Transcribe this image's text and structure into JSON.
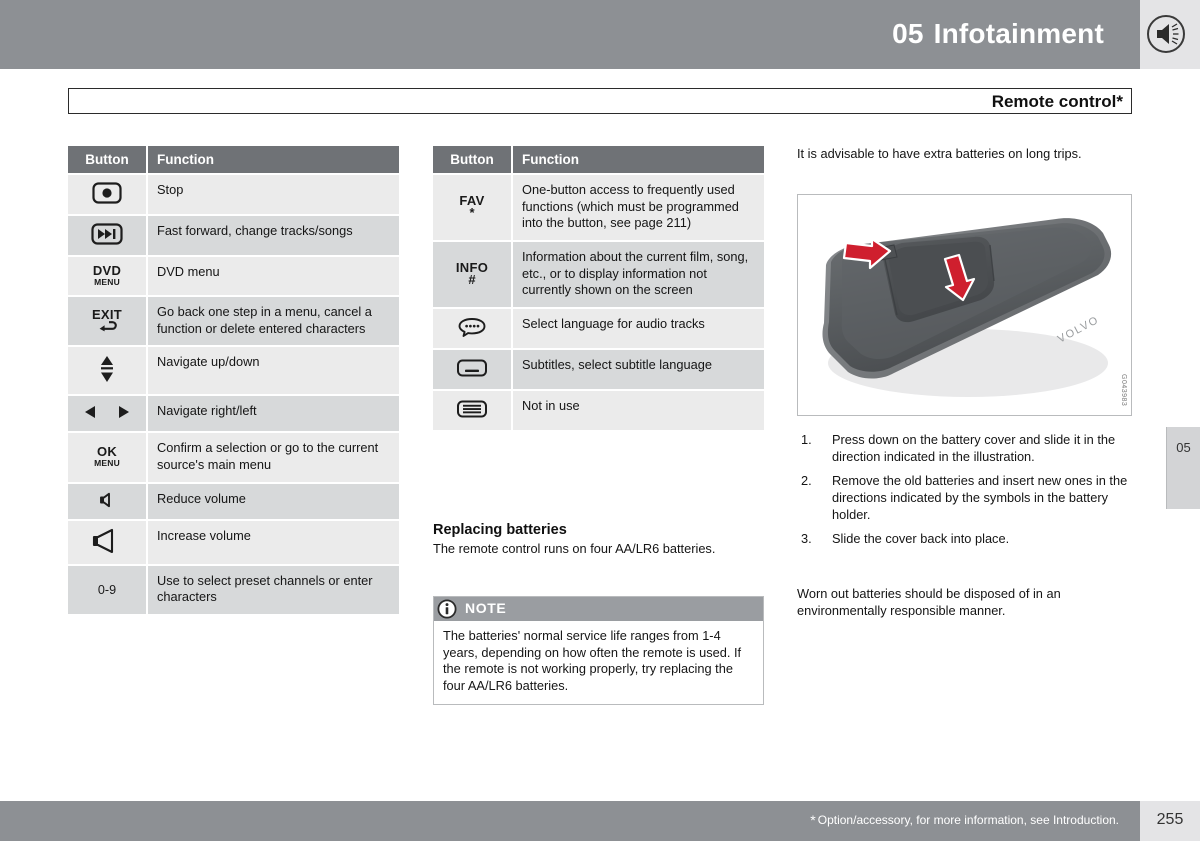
{
  "header": {
    "chapter_number": "05",
    "chapter_title": "Infotainment",
    "speaker_icon": "speaker-icon"
  },
  "section": {
    "title": "Remote control*"
  },
  "table_left": {
    "columns": [
      "Button",
      "Function"
    ],
    "rows": [
      {
        "button_icon": "stop-icon",
        "button_label": "",
        "function": "Stop"
      },
      {
        "button_icon": "fast-forward-icon",
        "button_label": "",
        "function": "Fast forward, change tracks/songs"
      },
      {
        "button_icon": "dvd-menu-text",
        "button_label": "DVD",
        "button_sublabel": "MENU",
        "function": "DVD menu"
      },
      {
        "button_icon": "exit-icon",
        "button_label": "EXIT",
        "function": "Go back one step in a menu, cancel a function or delete entered characters"
      },
      {
        "button_icon": "up-down-arrows-icon",
        "button_label": "",
        "function": "Navigate up/down"
      },
      {
        "button_icon": "left-right-arrows-icon",
        "button_label": "",
        "function": "Navigate right/left"
      },
      {
        "button_icon": "ok-menu-text",
        "button_label": "OK",
        "button_sublabel": "MENU",
        "function": "Confirm a selection or go to the current source's main menu"
      },
      {
        "button_icon": "volume-down-icon",
        "button_label": "",
        "function": "Reduce volume"
      },
      {
        "button_icon": "volume-up-icon",
        "button_label": "",
        "function": "Increase volume"
      },
      {
        "button_icon": "number-keys-text",
        "button_label": "0-9",
        "function": "Use to select preset channels or enter characters"
      }
    ]
  },
  "table_mid": {
    "columns": [
      "Button",
      "Function"
    ],
    "rows": [
      {
        "button_icon": "fav-star-text",
        "button_label": "FAV",
        "button_sublabel": "*",
        "function": "One-button access to frequently used functions (which must be programmed into the button, see page 211)"
      },
      {
        "button_icon": "info-hash-text",
        "button_label": "INFO",
        "button_sublabel": "#",
        "function": "Information about the current film, song, etc., or to display information not currently shown on the screen"
      },
      {
        "button_icon": "audio-language-icon",
        "button_label": "",
        "function": "Select language for audio tracks"
      },
      {
        "button_icon": "subtitles-icon",
        "button_label": "",
        "function": "Subtitles, select subtitle language"
      },
      {
        "button_icon": "list-icon",
        "button_label": "",
        "function": "Not in use"
      }
    ]
  },
  "replacing_batteries": {
    "heading": "Replacing batteries",
    "intro": "The remote control runs on four AA/LR6 batteries."
  },
  "note": {
    "icon": "info-icon",
    "label": "NOTE",
    "text": "The batteries' normal service life ranges from 1-4 years, depending on how often the remote is used. If the remote is not working properly, try replacing the four AA/LR6 batteries."
  },
  "right_column": {
    "intro": "It is advisable to have extra batteries on long trips.",
    "figure": {
      "alt": "remote-control-battery-cover-illustration",
      "code": "G043983"
    },
    "steps": [
      {
        "num": "1.",
        "text": "Press down on the battery cover and slide it in the direction indicated in the illustration."
      },
      {
        "num": "2.",
        "text": "Remove the old batteries and insert new ones in the directions indicated by the symbols in the battery holder."
      },
      {
        "num": "3.",
        "text": "Slide the cover back into place."
      }
    ],
    "closing": "Worn out batteries should be disposed of in an environmentally responsible manner."
  },
  "side_tab": {
    "label": "05"
  },
  "footer": {
    "note": "Option/accessory, for more information, see Introduction.",
    "page_number": "255"
  },
  "colors": {
    "header_grey": "#8d9094",
    "header_light": "#e4e4e6",
    "table_head": "#6f7276",
    "row_odd": "#ebebeb",
    "row_even": "#d7d9da",
    "note_head": "#9a9da1",
    "arrow_red": "#d0202f"
  }
}
